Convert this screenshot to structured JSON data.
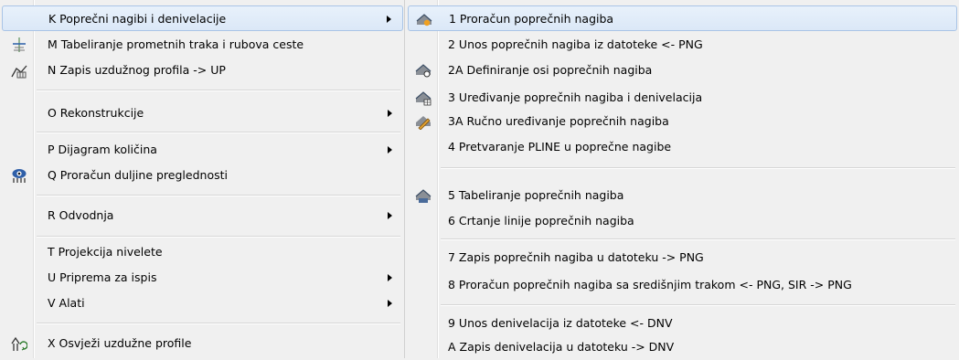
{
  "left_menu": {
    "items": [
      {
        "label": "K Poprečni nagibi i denivelacije",
        "icon": "",
        "submenu": true,
        "highlighted": true
      },
      {
        "label": "M Tabeliranje prometnih traka i rubova ceste",
        "icon": "lane-table-icon",
        "submenu": false
      },
      {
        "label": "N Zapis uzdužnog profila -> UP",
        "icon": "profile-export-icon",
        "submenu": false
      },
      {
        "label": "O Rekonstrukcije",
        "icon": "",
        "submenu": true
      },
      {
        "label": "P Dijagram količina",
        "icon": "",
        "submenu": true
      },
      {
        "label": "Q Proračun duljine preglednosti",
        "icon": "visibility-icon",
        "submenu": false
      },
      {
        "label": "R Odvodnja",
        "icon": "",
        "submenu": true
      },
      {
        "label": "T Projekcija nivelete",
        "icon": "",
        "submenu": false
      },
      {
        "label": "U Priprema za ispis",
        "icon": "",
        "submenu": true
      },
      {
        "label": "V Alati",
        "icon": "",
        "submenu": true
      },
      {
        "label": "X Osvježi uzdužne profile",
        "icon": "refresh-profile-icon",
        "submenu": false
      }
    ]
  },
  "right_menu": {
    "items": [
      {
        "label": "1 Proračun poprečnih nagiba",
        "icon": "cross-slope-calc-icon",
        "highlighted": true
      },
      {
        "label": "2 Unos poprečnih nagiba iz datoteke <- PNG",
        "icon": ""
      },
      {
        "label": "2A Definiranje osi poprečnih nagiba",
        "icon": "axis-define-icon"
      },
      {
        "label": "3 Uređivanje poprečnih nagiba i denivelacija",
        "icon": "edit-table-icon"
      },
      {
        "label": "3A Ručno uređivanje poprečnih nagiba",
        "icon": "pencil-edit-icon"
      },
      {
        "label": "4 Pretvaranje PLINE u poprečne nagibe",
        "icon": ""
      },
      {
        "label": "5 Tabeliranje poprečnih nagiba",
        "icon": "tabulate-icon"
      },
      {
        "label": "6 Crtanje linije poprečnih nagiba",
        "icon": ""
      },
      {
        "label": "7 Zapis poprečnih nagiba u datoteku -> PNG",
        "icon": ""
      },
      {
        "label": "8 Proračun poprečnih nagiba sa središnjim trakom <- PNG, SIR -> PNG",
        "icon": ""
      },
      {
        "label": "9 Unos denivelacija iz datoteke <- DNV",
        "icon": ""
      },
      {
        "label": "A Zapis denivelacija u datoteku -> DNV",
        "icon": ""
      }
    ]
  }
}
